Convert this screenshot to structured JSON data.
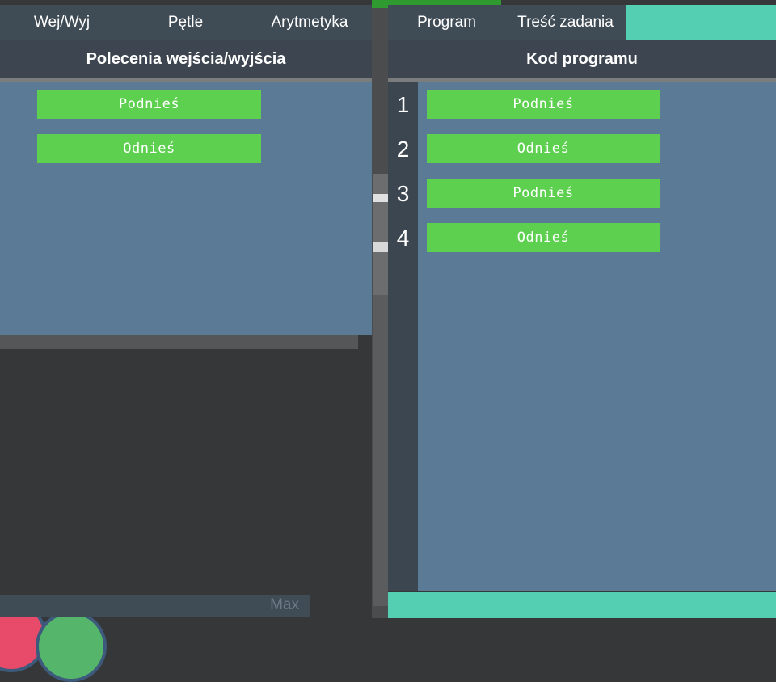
{
  "left_panel": {
    "tabs": [
      {
        "label": "Wej/Wyj"
      },
      {
        "label": "Pętle"
      },
      {
        "label": "Arytmetyka"
      }
    ],
    "header": "Polecenia wejścia/wyjścia",
    "commands": [
      {
        "label": "Podnieś"
      },
      {
        "label": "Odnieś"
      }
    ]
  },
  "right_panel": {
    "tabs": [
      {
        "label": "Program"
      },
      {
        "label": "Treść zadania"
      }
    ],
    "header": "Kod programu",
    "program": [
      {
        "line": "1",
        "label": "Podnieś"
      },
      {
        "line": "2",
        "label": "Odnieś"
      },
      {
        "line": "3",
        "label": "Podnieś"
      },
      {
        "line": "4",
        "label": "Odnieś"
      }
    ]
  },
  "speed_control": {
    "label": "Max"
  },
  "colors": {
    "command_green": "#5dd04f",
    "panel_blue": "#5a7a95",
    "header_dark": "#3d4650",
    "accent_teal": "#55cfb2"
  }
}
